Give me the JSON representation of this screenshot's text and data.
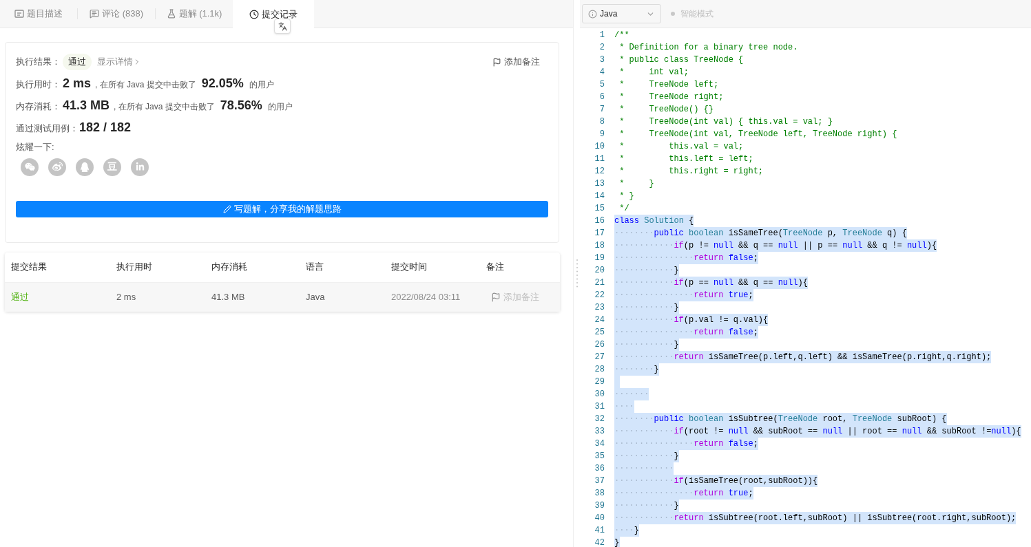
{
  "tabs": [
    {
      "label": "题目描述",
      "selected": false
    },
    {
      "label": "评论 (838)",
      "selected": false
    },
    {
      "label": "题解 (1.1k)",
      "selected": false
    },
    {
      "label": "提交记录",
      "selected": true
    }
  ],
  "result_card": {
    "status_label": "执行结果：",
    "status": "通过",
    "details_link": "显示详情",
    "add_note": "添加备注",
    "stats": [
      {
        "label": "执行用时：",
        "value": "2 ms",
        "beat_text": ", 在所有 Java 提交中击败了",
        "percent": "92.05%",
        "suffix": "的用户"
      },
      {
        "label": "内存消耗：",
        "value": "41.3 MB",
        "beat_text": ", 在所有 Java 提交中击败了",
        "percent": "78.56%",
        "suffix": "的用户"
      }
    ],
    "passed_label": "通过测试用例：",
    "passed_value": "182 / 182",
    "share_label": "炫耀一下:",
    "share_icons": [
      {
        "kind": "wechat"
      },
      {
        "kind": "weibo"
      },
      {
        "kind": "qq"
      },
      {
        "kind": "douban",
        "glyph": "豆"
      },
      {
        "kind": "linkedin"
      }
    ],
    "write_button": "写题解，分享我的解题思路"
  },
  "submissions": {
    "columns": [
      "提交结果",
      "执行用时",
      "内存消耗",
      "语言",
      "提交时间",
      "备注"
    ],
    "rows": [
      {
        "status": "通过",
        "kind": "accepted",
        "runtime": "2 ms",
        "memory": "41.3 MB",
        "language": "Java",
        "time": "2022/08/24 03:11",
        "note": "添加备注"
      }
    ]
  },
  "editor": {
    "language": "Java",
    "mode": "智能模式",
    "mode_on": false,
    "lines": [
      {
        "number": "1",
        "selected": false,
        "tokens": [
          {
            "t": "/**",
            "kind": "comment"
          }
        ]
      },
      {
        "number": "2",
        "selected": false,
        "tokens": [
          {
            "t": " * Definition for a binary tree node.",
            "kind": "comment"
          }
        ]
      },
      {
        "number": "3",
        "selected": false,
        "tokens": [
          {
            "t": " * public class TreeNode {",
            "kind": "comment"
          }
        ]
      },
      {
        "number": "4",
        "selected": false,
        "tokens": [
          {
            "t": " *     int val;",
            "kind": "comment"
          }
        ]
      },
      {
        "number": "5",
        "selected": false,
        "tokens": [
          {
            "t": " *     TreeNode left;",
            "kind": "comment"
          }
        ]
      },
      {
        "number": "6",
        "selected": false,
        "tokens": [
          {
            "t": " *     TreeNode right;",
            "kind": "comment"
          }
        ]
      },
      {
        "number": "7",
        "selected": false,
        "tokens": [
          {
            "t": " *     TreeNode() {}",
            "kind": "comment"
          }
        ]
      },
      {
        "number": "8",
        "selected": false,
        "tokens": [
          {
            "t": " *     TreeNode(int val) { this.val = val; }",
            "kind": "comment"
          }
        ]
      },
      {
        "number": "9",
        "selected": false,
        "tokens": [
          {
            "t": " *     TreeNode(int val, TreeNode left, TreeNode right) {",
            "kind": "comment"
          }
        ]
      },
      {
        "number": "10",
        "selected": false,
        "tokens": [
          {
            "t": " *         this.val = val;",
            "kind": "comment"
          }
        ]
      },
      {
        "number": "11",
        "selected": false,
        "tokens": [
          {
            "t": " *         this.left = left;",
            "kind": "comment"
          }
        ]
      },
      {
        "number": "12",
        "selected": false,
        "tokens": [
          {
            "t": " *         this.right = right;",
            "kind": "comment"
          }
        ]
      },
      {
        "number": "13",
        "selected": false,
        "tokens": [
          {
            "t": " *     }",
            "kind": "comment"
          }
        ]
      },
      {
        "number": "14",
        "selected": false,
        "tokens": [
          {
            "t": " * }",
            "kind": "comment"
          }
        ]
      },
      {
        "number": "15",
        "selected": false,
        "tokens": [
          {
            "t": " */",
            "kind": "comment"
          }
        ]
      },
      {
        "number": "16",
        "selected": true,
        "tokens": [
          {
            "t": "class",
            "kind": "keyword"
          },
          {
            "t": " Solution",
            "kind": "type"
          },
          {
            "t": " {",
            "kind": "plain"
          }
        ]
      },
      {
        "number": "17",
        "selected": true,
        "tokens": [
          {
            "t": "········",
            "kind": "whitespace"
          },
          {
            "t": "public",
            "kind": "keyword"
          },
          {
            "t": " boolean",
            "kind": "type"
          },
          {
            "t": " isSameTree(",
            "kind": "plain"
          },
          {
            "t": "TreeNode",
            "kind": "type"
          },
          {
            "t": " p, ",
            "kind": "plain"
          },
          {
            "t": "TreeNode",
            "kind": "type"
          },
          {
            "t": " q) {",
            "kind": "plain"
          }
        ]
      },
      {
        "number": "18",
        "selected": true,
        "tokens": [
          {
            "t": "············",
            "kind": "whitespace"
          },
          {
            "t": "if",
            "kind": "control"
          },
          {
            "t": "(p != ",
            "kind": "plain"
          },
          {
            "t": "null",
            "kind": "keyword"
          },
          {
            "t": " && q == ",
            "kind": "plain"
          },
          {
            "t": "null",
            "kind": "keyword"
          },
          {
            "t": " || p == ",
            "kind": "plain"
          },
          {
            "t": "null",
            "kind": "keyword"
          },
          {
            "t": " && q != ",
            "kind": "plain"
          },
          {
            "t": "null",
            "kind": "keyword"
          },
          {
            "t": "){",
            "kind": "plain"
          }
        ]
      },
      {
        "number": "19",
        "selected": true,
        "tokens": [
          {
            "t": "················",
            "kind": "whitespace"
          },
          {
            "t": "return",
            "kind": "control"
          },
          {
            "t": " false",
            "kind": "keyword"
          },
          {
            "t": ";",
            "kind": "plain"
          }
        ]
      },
      {
        "number": "20",
        "selected": true,
        "tokens": [
          {
            "t": "············",
            "kind": "whitespace"
          },
          {
            "t": "}",
            "kind": "plain"
          }
        ]
      },
      {
        "number": "21",
        "selected": true,
        "tokens": [
          {
            "t": "············",
            "kind": "whitespace"
          },
          {
            "t": "if",
            "kind": "control"
          },
          {
            "t": "(p == ",
            "kind": "plain"
          },
          {
            "t": "null",
            "kind": "keyword"
          },
          {
            "t": " && q == ",
            "kind": "plain"
          },
          {
            "t": "null",
            "kind": "keyword"
          },
          {
            "t": "){",
            "kind": "plain"
          }
        ]
      },
      {
        "number": "22",
        "selected": true,
        "tokens": [
          {
            "t": "················",
            "kind": "whitespace"
          },
          {
            "t": "return",
            "kind": "control"
          },
          {
            "t": " true",
            "kind": "keyword"
          },
          {
            "t": ";",
            "kind": "plain"
          }
        ]
      },
      {
        "number": "23",
        "selected": true,
        "tokens": [
          {
            "t": "············",
            "kind": "whitespace"
          },
          {
            "t": "}",
            "kind": "plain"
          }
        ]
      },
      {
        "number": "24",
        "selected": true,
        "tokens": [
          {
            "t": "············",
            "kind": "whitespace"
          },
          {
            "t": "if",
            "kind": "control"
          },
          {
            "t": "(p.val != q.val){",
            "kind": "plain"
          }
        ]
      },
      {
        "number": "25",
        "selected": true,
        "tokens": [
          {
            "t": "················",
            "kind": "whitespace"
          },
          {
            "t": "return",
            "kind": "control"
          },
          {
            "t": " false",
            "kind": "keyword"
          },
          {
            "t": ";",
            "kind": "plain"
          }
        ]
      },
      {
        "number": "26",
        "selected": true,
        "tokens": [
          {
            "t": "············",
            "kind": "whitespace"
          },
          {
            "t": "}",
            "kind": "plain"
          }
        ]
      },
      {
        "number": "27",
        "selected": true,
        "tokens": [
          {
            "t": "············",
            "kind": "whitespace"
          },
          {
            "t": "return",
            "kind": "control"
          },
          {
            "t": " isSameTree(p.left,q.left) && isSameTree(p.right,q.right);",
            "kind": "plain"
          }
        ]
      },
      {
        "number": "28",
        "selected": true,
        "tokens": [
          {
            "t": "········",
            "kind": "whitespace"
          },
          {
            "t": "}",
            "kind": "plain"
          }
        ]
      },
      {
        "number": "29",
        "selected": true
      },
      {
        "number": "30",
        "selected": true,
        "tokens": [
          {
            "t": "·······",
            "kind": "whitespace"
          }
        ]
      },
      {
        "number": "31",
        "selected": true,
        "tokens": [
          {
            "t": "····",
            "kind": "whitespace"
          }
        ]
      },
      {
        "number": "32",
        "selected": true,
        "tokens": [
          {
            "t": "········",
            "kind": "whitespace"
          },
          {
            "t": "public",
            "kind": "keyword"
          },
          {
            "t": " boolean",
            "kind": "type"
          },
          {
            "t": " isSubtree(",
            "kind": "plain"
          },
          {
            "t": "TreeNode",
            "kind": "type"
          },
          {
            "t": " root, ",
            "kind": "plain"
          },
          {
            "t": "TreeNode",
            "kind": "type"
          },
          {
            "t": " subRoot) {",
            "kind": "plain"
          }
        ]
      },
      {
        "number": "33",
        "selected": true,
        "tokens": [
          {
            "t": "············",
            "kind": "whitespace"
          },
          {
            "t": "if",
            "kind": "control"
          },
          {
            "t": "(root != ",
            "kind": "plain"
          },
          {
            "t": "null",
            "kind": "keyword"
          },
          {
            "t": " && subRoot == ",
            "kind": "plain"
          },
          {
            "t": "null",
            "kind": "keyword"
          },
          {
            "t": " || root == ",
            "kind": "plain"
          },
          {
            "t": "null",
            "kind": "keyword"
          },
          {
            "t": " && subRoot !=",
            "kind": "plain"
          },
          {
            "t": "null",
            "kind": "keyword"
          },
          {
            "t": "){",
            "kind": "plain"
          }
        ]
      },
      {
        "number": "34",
        "selected": true,
        "tokens": [
          {
            "t": "················",
            "kind": "whitespace"
          },
          {
            "t": "return",
            "kind": "control"
          },
          {
            "t": " false",
            "kind": "keyword"
          },
          {
            "t": ";",
            "kind": "plain"
          }
        ]
      },
      {
        "number": "35",
        "selected": true,
        "tokens": [
          {
            "t": "············",
            "kind": "whitespace"
          },
          {
            "t": "}",
            "kind": "plain"
          }
        ]
      },
      {
        "number": "36",
        "selected": true,
        "tokens": [
          {
            "t": "············",
            "kind": "whitespace"
          }
        ]
      },
      {
        "number": "37",
        "selected": true,
        "tokens": [
          {
            "t": "············",
            "kind": "whitespace"
          },
          {
            "t": "if",
            "kind": "control"
          },
          {
            "t": "(isSameTree(root,subRoot)){",
            "kind": "plain"
          }
        ]
      },
      {
        "number": "38",
        "selected": true,
        "tokens": [
          {
            "t": "················",
            "kind": "whitespace"
          },
          {
            "t": "return",
            "kind": "control"
          },
          {
            "t": " true",
            "kind": "keyword"
          },
          {
            "t": ";",
            "kind": "plain"
          }
        ]
      },
      {
        "number": "39",
        "selected": true,
        "tokens": [
          {
            "t": "············",
            "kind": "whitespace"
          },
          {
            "t": "}",
            "kind": "plain"
          }
        ]
      },
      {
        "number": "40",
        "selected": true,
        "tokens": [
          {
            "t": "············",
            "kind": "whitespace"
          },
          {
            "t": "return",
            "kind": "control"
          },
          {
            "t": " isSubtree(root.left,subRoot) || isSubtree(root.right,subRoot);",
            "kind": "plain"
          }
        ]
      },
      {
        "number": "41",
        "selected": true,
        "tokens": [
          {
            "t": "····",
            "kind": "whitespace"
          },
          {
            "t": "}",
            "kind": "plain"
          }
        ]
      },
      {
        "number": "42",
        "selected": true,
        "tokens": [
          {
            "t": "}",
            "kind": "plain"
          }
        ]
      }
    ]
  }
}
